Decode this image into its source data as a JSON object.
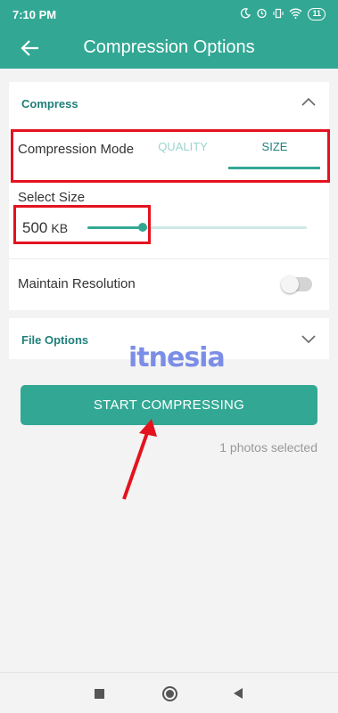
{
  "status_bar": {
    "time": "7:10 PM",
    "battery": "11",
    "icons": [
      "moon-icon",
      "alarm-icon",
      "vibrate-icon",
      "wifi-icon",
      "battery-icon"
    ]
  },
  "app_bar": {
    "title": "Compression Options",
    "back_icon": "arrow-left-icon"
  },
  "compress_section": {
    "title": "Compress",
    "expanded": true,
    "mode_label": "Compression Mode",
    "tabs": [
      {
        "label": "QUALITY",
        "selected": false
      },
      {
        "label": "SIZE",
        "selected": true
      }
    ],
    "select_size_label": "Select Size",
    "size_value": "500",
    "size_unit": "KB",
    "slider_fraction": 0.25,
    "maintain_resolution_label": "Maintain Resolution",
    "maintain_resolution_on": false
  },
  "file_options": {
    "title": "File Options",
    "expanded": false
  },
  "watermark": "itnesia",
  "start_button": "START COMPRESSING",
  "selected_count_text": "1 photos selected",
  "colors": {
    "primary": "#32a894",
    "accent_text": "#20807a",
    "annotation_red": "#e4121f",
    "watermark": "#7b8de6"
  }
}
